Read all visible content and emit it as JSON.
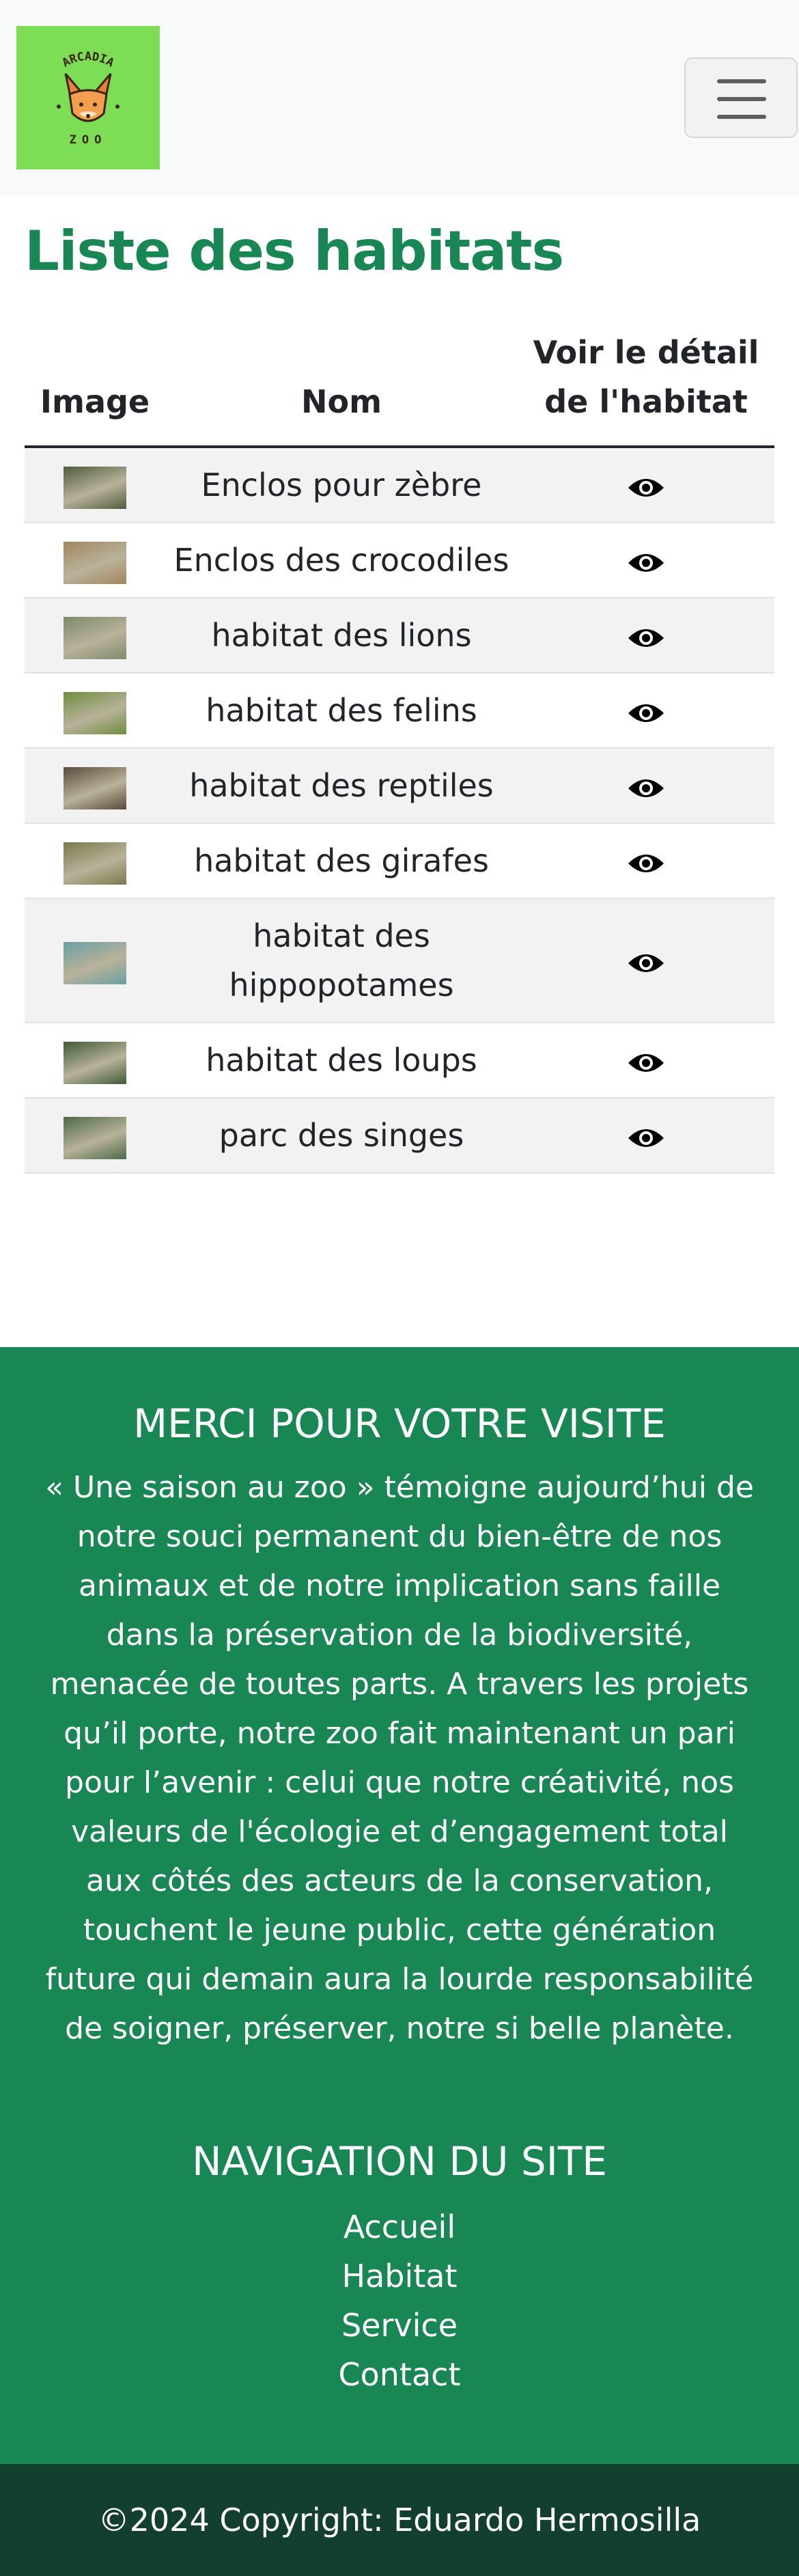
{
  "header": {
    "logo_text_top": "ARCADIA",
    "logo_text_bottom": "ZOO",
    "menu_toggle_label": "menu"
  },
  "main": {
    "title": "Liste des habitats",
    "table": {
      "headers": [
        "Image",
        "Nom",
        "Voir le détail de l'habitat"
      ],
      "rows": [
        {
          "name": "Enclos pour zèbre",
          "thumb_color": "#4f5d3f"
        },
        {
          "name": "Enclos des crocodiles",
          "thumb_color": "#a3865f"
        },
        {
          "name": "habitat des lions",
          "thumb_color": "#7d8b6b"
        },
        {
          "name": "habitat des felins",
          "thumb_color": "#6d8e3f"
        },
        {
          "name": "habitat des reptiles",
          "thumb_color": "#5b4a3b"
        },
        {
          "name": "habitat des girafes",
          "thumb_color": "#7a7a4a"
        },
        {
          "name": "habitat des hippopotames",
          "thumb_color": "#6aa0a3"
        },
        {
          "name": "habitat des loups",
          "thumb_color": "#3f5a36"
        },
        {
          "name": "parc des singes",
          "thumb_color": "#4d6a49"
        }
      ],
      "detail_icon": "eye-icon"
    }
  },
  "footer": {
    "merci_title": "MERCI POUR VOTRE VISITE",
    "merci_text": "« Une saison au zoo » témoigne aujourd’hui de notre souci permanent du bien-être de nos animaux et de notre implication sans faille dans la préservation de la biodiversité, menacée de toutes parts. A travers les projets qu’il porte, notre zoo fait maintenant un pari pour l’avenir : celui que notre créativité, nos valeurs de l'écologie et d’engagement total aux côtés des acteurs de la conservation, touchent le jeune public, cette génération future qui demain aura la lourde responsabilité de soigner, préserver, notre si belle planète.",
    "nav_title": "NAVIGATION DU SITE",
    "nav_links": [
      "Accueil",
      "Habitat",
      "Service",
      "Contact"
    ],
    "copyright": "©2024 Copyright: Eduardo Hermosilla"
  },
  "colors": {
    "accent": "#198754",
    "logo_bg": "#7dde55",
    "copyright_bg": "#13402e"
  }
}
